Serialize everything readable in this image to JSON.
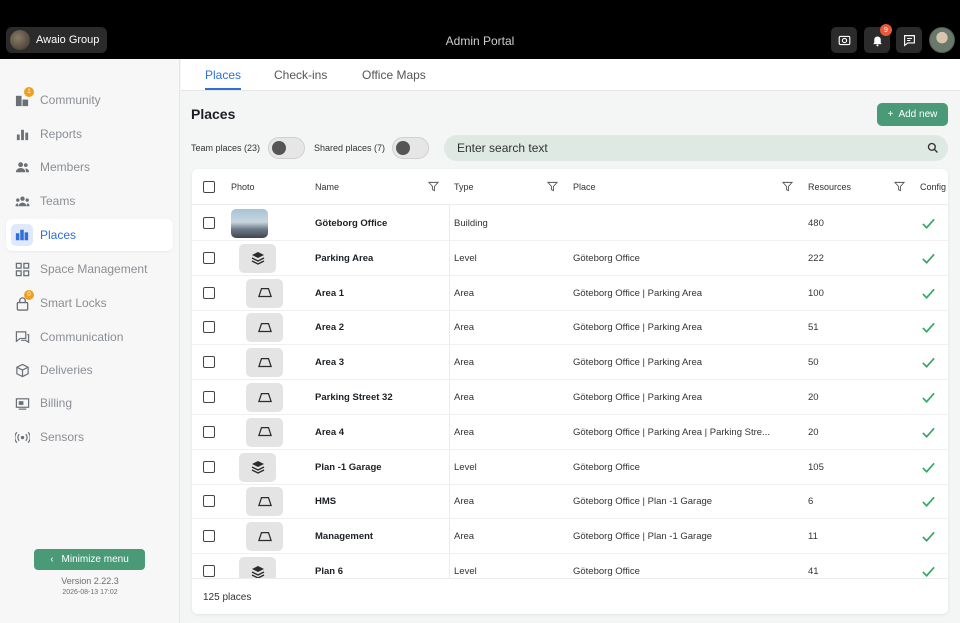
{
  "topbar": {
    "org_name": "Awaio Group",
    "app_title": "Admin Portal",
    "notification_count": "9"
  },
  "sidebar": {
    "items": [
      {
        "label": "Community",
        "icon": "community-icon",
        "badge": "1"
      },
      {
        "label": "Reports",
        "icon": "bar-chart-icon"
      },
      {
        "label": "Members",
        "icon": "members-icon"
      },
      {
        "label": "Teams",
        "icon": "teams-icon"
      },
      {
        "label": "Places",
        "icon": "buildings-icon",
        "active": true
      },
      {
        "label": "Space Management",
        "icon": "grid-icon"
      },
      {
        "label": "Smart Locks",
        "icon": "lock-icon",
        "badge": "0"
      },
      {
        "label": "Communication",
        "icon": "chat-icon"
      },
      {
        "label": "Deliveries",
        "icon": "box-icon"
      },
      {
        "label": "Billing",
        "icon": "billing-icon"
      },
      {
        "label": "Sensors",
        "icon": "sensor-icon"
      }
    ],
    "minimize_label": "Minimize menu",
    "version": "Version 2.22.3",
    "build": "2026-08-13 17:02"
  },
  "tabs": [
    {
      "label": "Places",
      "active": true
    },
    {
      "label": "Check-ins"
    },
    {
      "label": "Office Maps"
    }
  ],
  "page": {
    "title": "Places",
    "add_new_label": "Add new",
    "team_places_label": "Team places (23)",
    "shared_places_label": "Shared places (7)",
    "search_placeholder": "Enter search text"
  },
  "table": {
    "columns": [
      "Photo",
      "Name",
      "Type",
      "Place",
      "Resources",
      "Config"
    ],
    "rows": [
      {
        "thumb": "photo",
        "name": "Göteborg Office",
        "type": "Building",
        "place": "",
        "resources": "480"
      },
      {
        "thumb": "level",
        "name": "Parking Area",
        "type": "Level",
        "place": "Göteborg Office",
        "resources": "222"
      },
      {
        "thumb": "area",
        "name": "Area 1",
        "type": "Area",
        "place": "Göteborg Office | Parking Area",
        "resources": "100"
      },
      {
        "thumb": "area",
        "name": "Area 2",
        "type": "Area",
        "place": "Göteborg Office | Parking Area",
        "resources": "51"
      },
      {
        "thumb": "area",
        "name": "Area 3",
        "type": "Area",
        "place": "Göteborg Office | Parking Area",
        "resources": "50"
      },
      {
        "thumb": "area",
        "name": "Parking Street 32",
        "type": "Area",
        "place": "Göteborg Office | Parking Area",
        "resources": "20"
      },
      {
        "thumb": "area",
        "name": "Area 4",
        "type": "Area",
        "place": "Göteborg Office | Parking Area | Parking Stre...",
        "resources": "20"
      },
      {
        "thumb": "level",
        "name": "Plan -1 Garage",
        "type": "Level",
        "place": "Göteborg Office",
        "resources": "105"
      },
      {
        "thumb": "area",
        "name": "HMS",
        "type": "Area",
        "place": "Göteborg Office | Plan -1 Garage",
        "resources": "6"
      },
      {
        "thumb": "area",
        "name": "Management",
        "type": "Area",
        "place": "Göteborg Office | Plan -1 Garage",
        "resources": "11"
      },
      {
        "thumb": "level",
        "name": "Plan 6",
        "type": "Level",
        "place": "Göteborg Office",
        "resources": "41"
      }
    ],
    "footer": "125 places"
  },
  "colors": {
    "accent_green": "#4a9a78",
    "accent_blue": "#2e6fd8",
    "check_green": "#3aa66a"
  }
}
